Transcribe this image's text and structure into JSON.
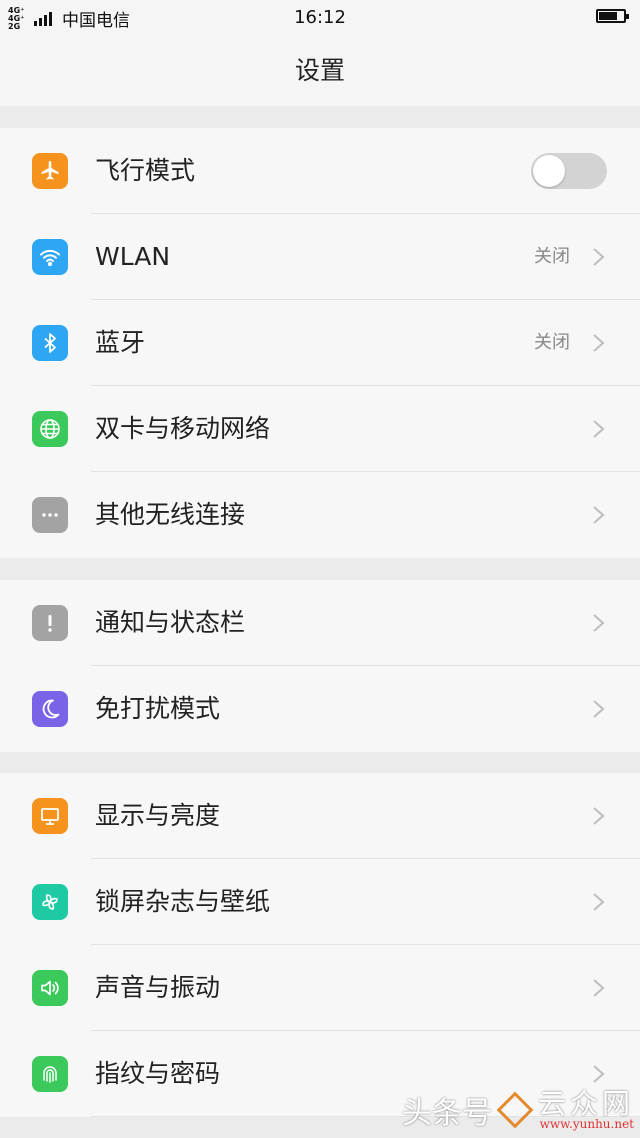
{
  "status_bar": {
    "network_type": "4G⁺ 4G⁺ 2G",
    "carrier": "中国电信",
    "time": "16:12",
    "battery_level": 0.75
  },
  "header": {
    "title": "设置"
  },
  "groups": [
    {
      "items": [
        {
          "label": "飞行模式",
          "icon": "airplane-icon",
          "color": "#f5931e",
          "toggle": false
        },
        {
          "label": "WLAN",
          "icon": "wifi-icon",
          "color": "#2ea6f4",
          "value": "关闭"
        },
        {
          "label": "蓝牙",
          "icon": "bluetooth-icon",
          "color": "#2ea6f4",
          "value": "关闭"
        },
        {
          "label": "双卡与移动网络",
          "icon": "globe-icon",
          "color": "#3cc95b"
        },
        {
          "label": "其他无线连接",
          "icon": "more-dots-icon",
          "color": "#a3a3a3"
        }
      ]
    },
    {
      "items": [
        {
          "label": "通知与状态栏",
          "icon": "exclamation-icon",
          "color": "#a3a3a3"
        },
        {
          "label": "免打扰模式",
          "icon": "moon-icon",
          "color": "#7a63e6"
        }
      ]
    },
    {
      "items": [
        {
          "label": "显示与亮度",
          "icon": "display-icon",
          "color": "#f5931e"
        },
        {
          "label": "锁屏杂志与壁纸",
          "icon": "pinwheel-icon",
          "color": "#1ecaa3"
        },
        {
          "label": "声音与振动",
          "icon": "speaker-icon",
          "color": "#3cc95b"
        },
        {
          "label": "指纹与密码",
          "icon": "fingerprint-icon",
          "color": "#3cc95b"
        }
      ]
    }
  ],
  "watermark": {
    "text": "头条号",
    "site_name": "云众网",
    "site_url": "www.yunhu.net"
  }
}
